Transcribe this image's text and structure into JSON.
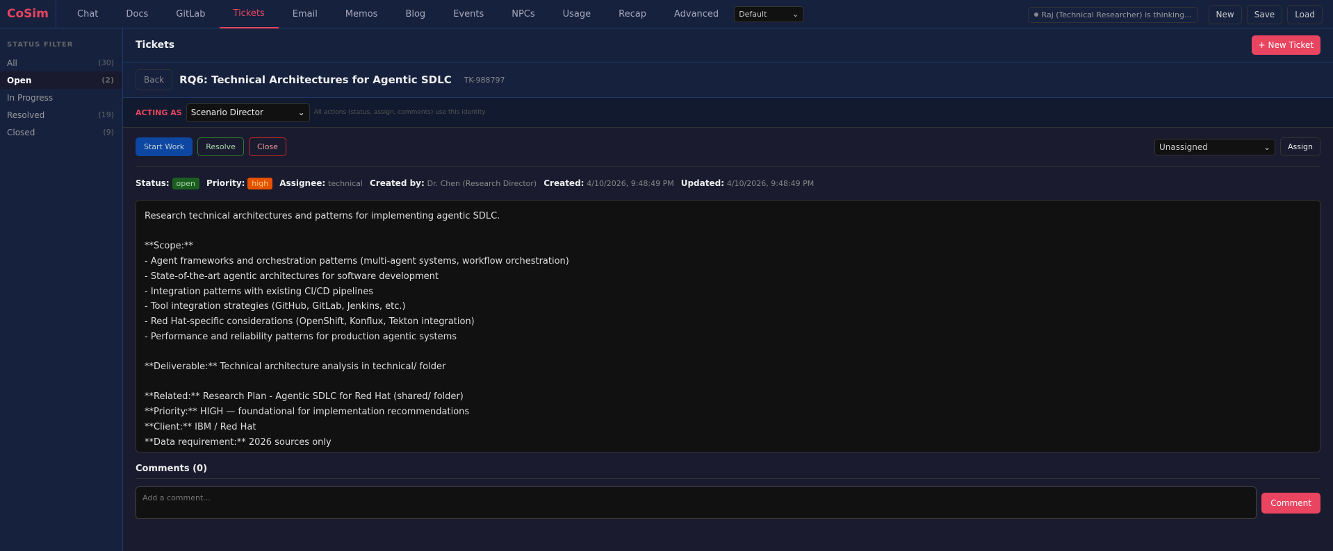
{
  "app": {
    "logo": "CoSim",
    "tabs": [
      "Chat",
      "Docs",
      "GitLab",
      "Tickets",
      "Email",
      "Memos",
      "Blog",
      "Events",
      "NPCs",
      "Usage",
      "Recap",
      "Advanced"
    ],
    "active_tab": "Tickets",
    "scenario_select": "Default",
    "status": "Raj (Technical Researcher) is thinking...",
    "buttons": {
      "new": "New",
      "save": "Save",
      "load": "Load"
    }
  },
  "sidebar": {
    "heading": "STATUS FILTER",
    "items": [
      {
        "label": "All",
        "count": "(30)"
      },
      {
        "label": "Open",
        "count": "(2)"
      },
      {
        "label": "In Progress",
        "count": ""
      },
      {
        "label": "Resolved",
        "count": "(19)"
      },
      {
        "label": "Closed",
        "count": "(9)"
      }
    ]
  },
  "page": {
    "title": "Tickets",
    "new_ticket": "+ New Ticket"
  },
  "ticket": {
    "back": "Back",
    "title": "RQ6: Technical Architectures for Agentic SDLC",
    "id": "TK-988797",
    "acting_label": "ACTING AS",
    "acting_value": "Scenario Director",
    "acting_hint": "All actions (status, assign, comments) use this identity",
    "actions": {
      "start": "Start Work",
      "resolve": "Resolve",
      "close": "Close",
      "assign_select": "Unassigned",
      "assign": "Assign"
    },
    "meta": {
      "status_label": "Status:",
      "status": "open",
      "priority_label": "Priority:",
      "priority": "high",
      "assignee_label": "Assignee:",
      "assignee": "technical",
      "created_by_label": "Created by:",
      "created_by": "Dr. Chen (Research Director)",
      "created_label": "Created:",
      "created": "4/10/2026, 9:48:49 PM",
      "updated_label": "Updated:",
      "updated": "4/10/2026, 9:48:49 PM"
    },
    "description": "Research technical architectures and patterns for implementing agentic SDLC.\n\n**Scope:**\n- Agent frameworks and orchestration patterns (multi-agent systems, workflow orchestration)\n- State-of-the-art agentic architectures for software development\n- Integration patterns with existing CI/CD pipelines\n- Tool integration strategies (GitHub, GitLab, Jenkins, etc.)\n- Red Hat-specific considerations (OpenShift, Konflux, Tekton integration)\n- Performance and reliability patterns for production agentic systems\n\n**Deliverable:** Technical architecture analysis in technical/ folder\n\n**Related:** Research Plan - Agentic SDLC for Red Hat (shared/ folder)\n**Priority:** HIGH — foundational for implementation recommendations\n**Client:** IBM / Red Hat\n**Data requirement:** 2026 sources only",
    "comments_heading": "Comments (0)",
    "comment_placeholder": "Add a comment...",
    "comment_button": "Comment"
  },
  "colors": {
    "accent": "#e94560",
    "open": "#1b5e20",
    "high": "#e65100"
  }
}
